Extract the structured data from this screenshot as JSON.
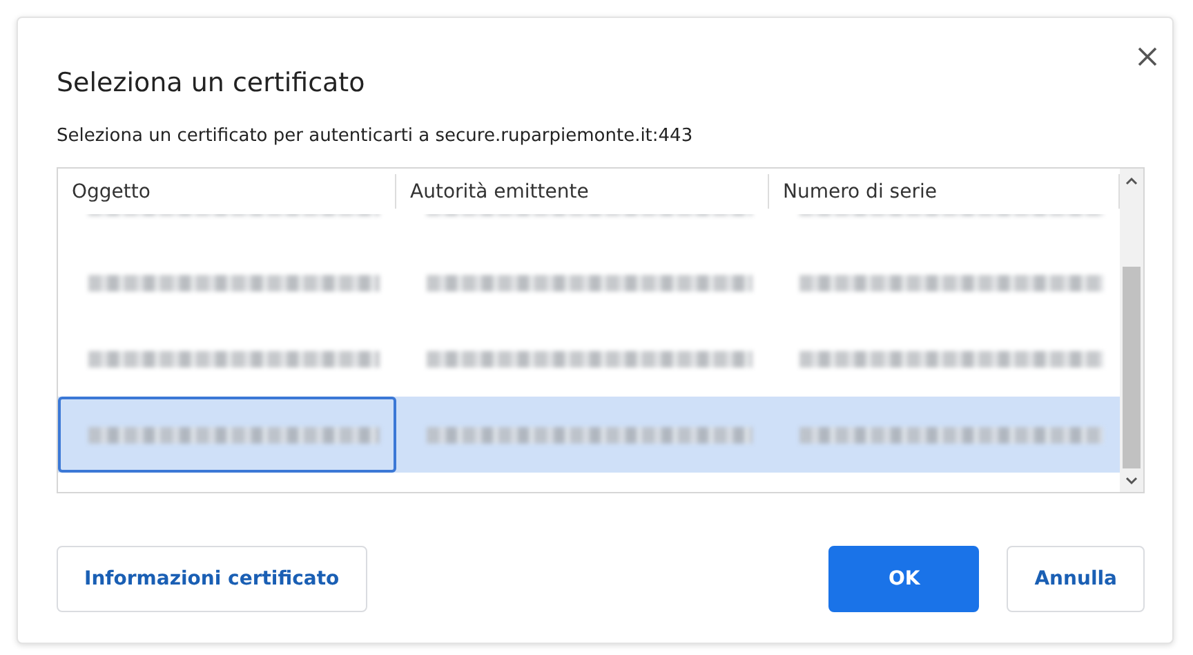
{
  "dialog": {
    "title": "Seleziona un certificato",
    "subtitle": "Seleziona un certificato per autenticarti a secure.ruparpiemonte.it:443"
  },
  "table": {
    "columns": [
      "Oggetto",
      "Autorità emittente",
      "Numero di serie"
    ],
    "rows": [
      {
        "selected": false,
        "partial": true
      },
      {
        "selected": false,
        "partial": false
      },
      {
        "selected": false,
        "partial": false
      },
      {
        "selected": true,
        "partial": false
      }
    ]
  },
  "buttons": [
    {
      "label": "Informazioni certificato",
      "kind": "secondary"
    },
    {
      "label": "OK",
      "kind": "primary"
    },
    {
      "label": "Annulla",
      "kind": "secondary"
    }
  ]
}
